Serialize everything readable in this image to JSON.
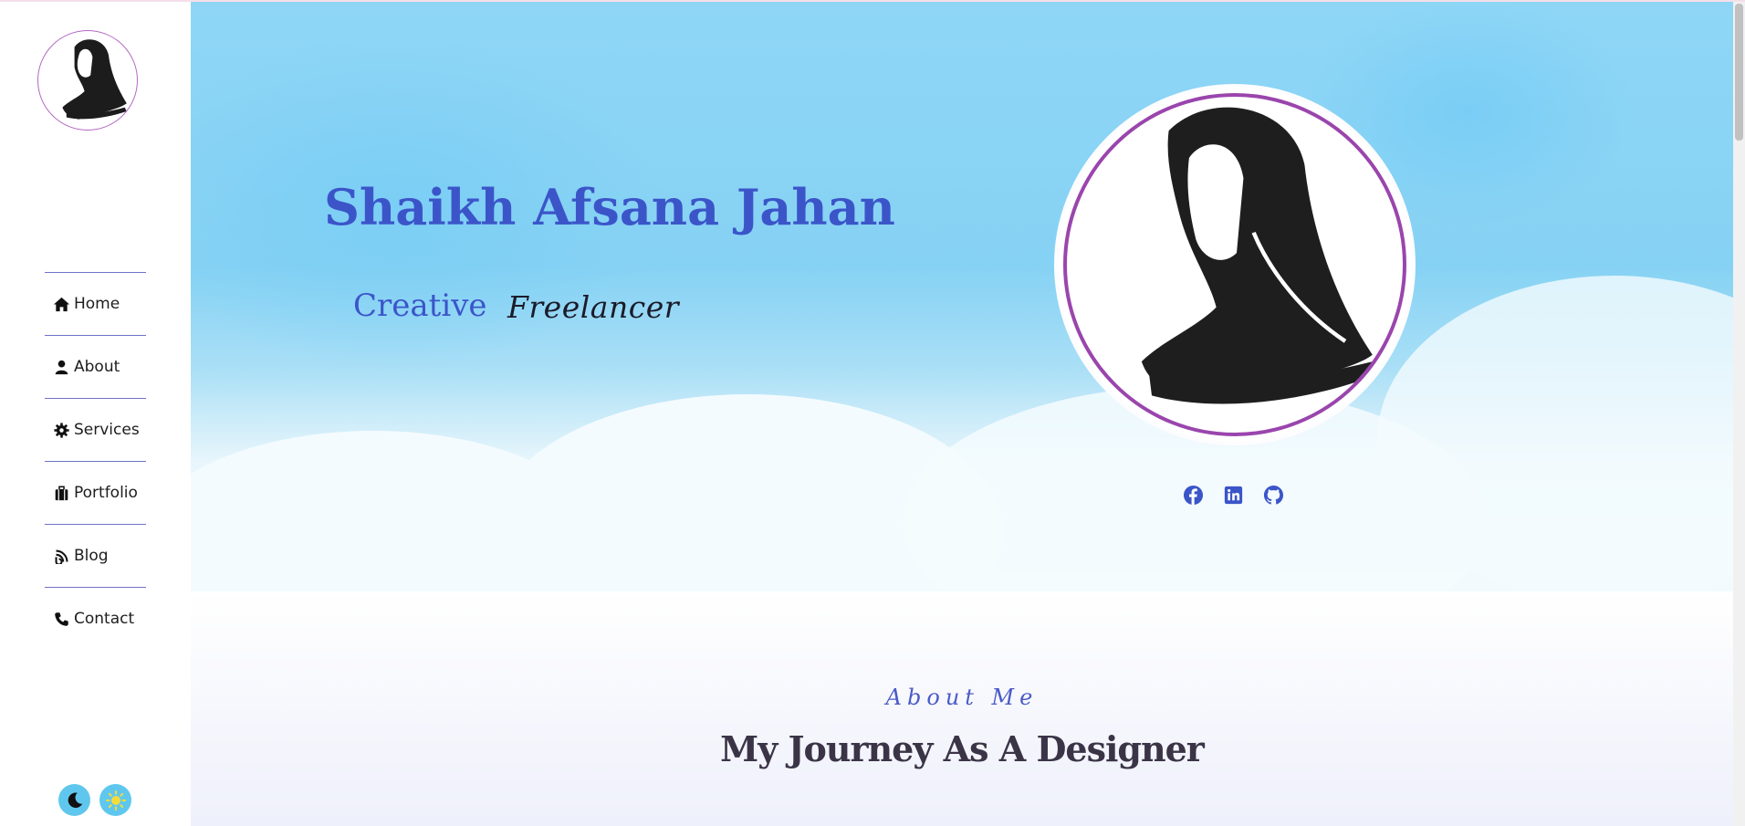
{
  "colors": {
    "accent_blue": "#3b55c9",
    "avatar_ring": "#9a45ad",
    "nav_divider": "#6f72c8",
    "toggle_bg": "#5fc7ee"
  },
  "sidebar": {
    "avatar_icon": "hijab-woman-icon",
    "nav": [
      {
        "label": "Home",
        "icon": "home-icon"
      },
      {
        "label": "About",
        "icon": "user-icon"
      },
      {
        "label": "Services",
        "icon": "gear-icon"
      },
      {
        "label": "Portfolio",
        "icon": "briefcase-icon"
      },
      {
        "label": "Blog",
        "icon": "blog-icon"
      },
      {
        "label": "Contact",
        "icon": "phone-icon"
      }
    ],
    "theme_toggles": [
      {
        "name": "dark-mode",
        "icon": "moon-icon"
      },
      {
        "name": "light-mode",
        "icon": "sun-icon"
      }
    ]
  },
  "hero": {
    "name": "Shaikh Afsana Jahan",
    "role_prefix": "Creative",
    "role_word": "Freelancer",
    "socials": [
      "facebook-icon",
      "linkedin-icon",
      "github-icon"
    ]
  },
  "about": {
    "kicker": "About Me",
    "title": "My Journey As A Designer"
  }
}
